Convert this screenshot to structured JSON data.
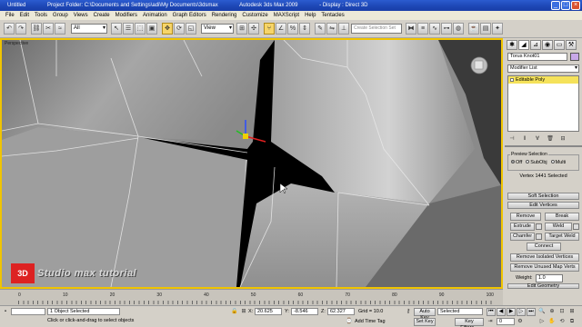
{
  "window": {
    "title_file": "Untitled",
    "title_project": "Project Folder: C:\\Documents and Settings\\adi\\My Documents\\3dsmax",
    "title_app": "Autodesk 3ds Max  2009",
    "title_display": "- Display : Direct 3D"
  },
  "menu": [
    "File",
    "Edit",
    "Tools",
    "Group",
    "Views",
    "Create",
    "Modifiers",
    "Animation",
    "Graph Editors",
    "Rendering",
    "Customize",
    "MAXScript",
    "Help",
    "Tentacles"
  ],
  "toolbar": {
    "selection_filter": "All",
    "reference_coord": "View",
    "named_selection_placeholder": "Create Selection Set"
  },
  "viewport": {
    "label": "Perspective"
  },
  "watermark": {
    "logo": "3D",
    "text": "Studio max tutorial"
  },
  "command_panel": {
    "object_name": "Torus Knot01",
    "object_color": "#c8a8e8",
    "modifier_list_label": "Modifier List",
    "stack_item": "Editable Poly",
    "preview_selection": {
      "legend": "Preview Selection",
      "options": [
        "Off",
        "SubObj",
        "Multi"
      ],
      "selected": "Off"
    },
    "selection_info": "Vertex 1441 Selected",
    "soft_selection_title": "Soft Selection",
    "edit_vertices_title": "Edit Vertices",
    "buttons": {
      "remove": "Remove",
      "break": "Break",
      "extrude": "Extrude",
      "weld": "Weld",
      "chamfer": "Chamfer",
      "target_weld": "Target Weld",
      "connect": "Connect",
      "remove_isolated": "Remove Isolated Vertices",
      "remove_unused_map": "Remove Unused Map Verts"
    },
    "weight_label": "Weight:",
    "weight_value": "1.0",
    "edit_geometry_title": "Edit Geometry"
  },
  "timeline": {
    "ticks": [
      "0",
      "10",
      "20",
      "30",
      "40",
      "50",
      "60",
      "70",
      "80",
      "90",
      "100"
    ]
  },
  "status": {
    "selected_count": "1 Object Selected",
    "prompt": "Click or click-and-drag to select objects",
    "x_label": "X:",
    "x_value": "20.625",
    "y_label": "Y:",
    "y_value": "-8.546",
    "z_label": "Z:",
    "z_value": "62.327",
    "grid": "Grid = 10.0",
    "add_time_tag": "Add Time Tag",
    "auto_key": "Auto Key",
    "set_key": "Set Key",
    "selected_dropdown": "Selected",
    "key_filters": "Key Filters...",
    "frame": "0"
  }
}
